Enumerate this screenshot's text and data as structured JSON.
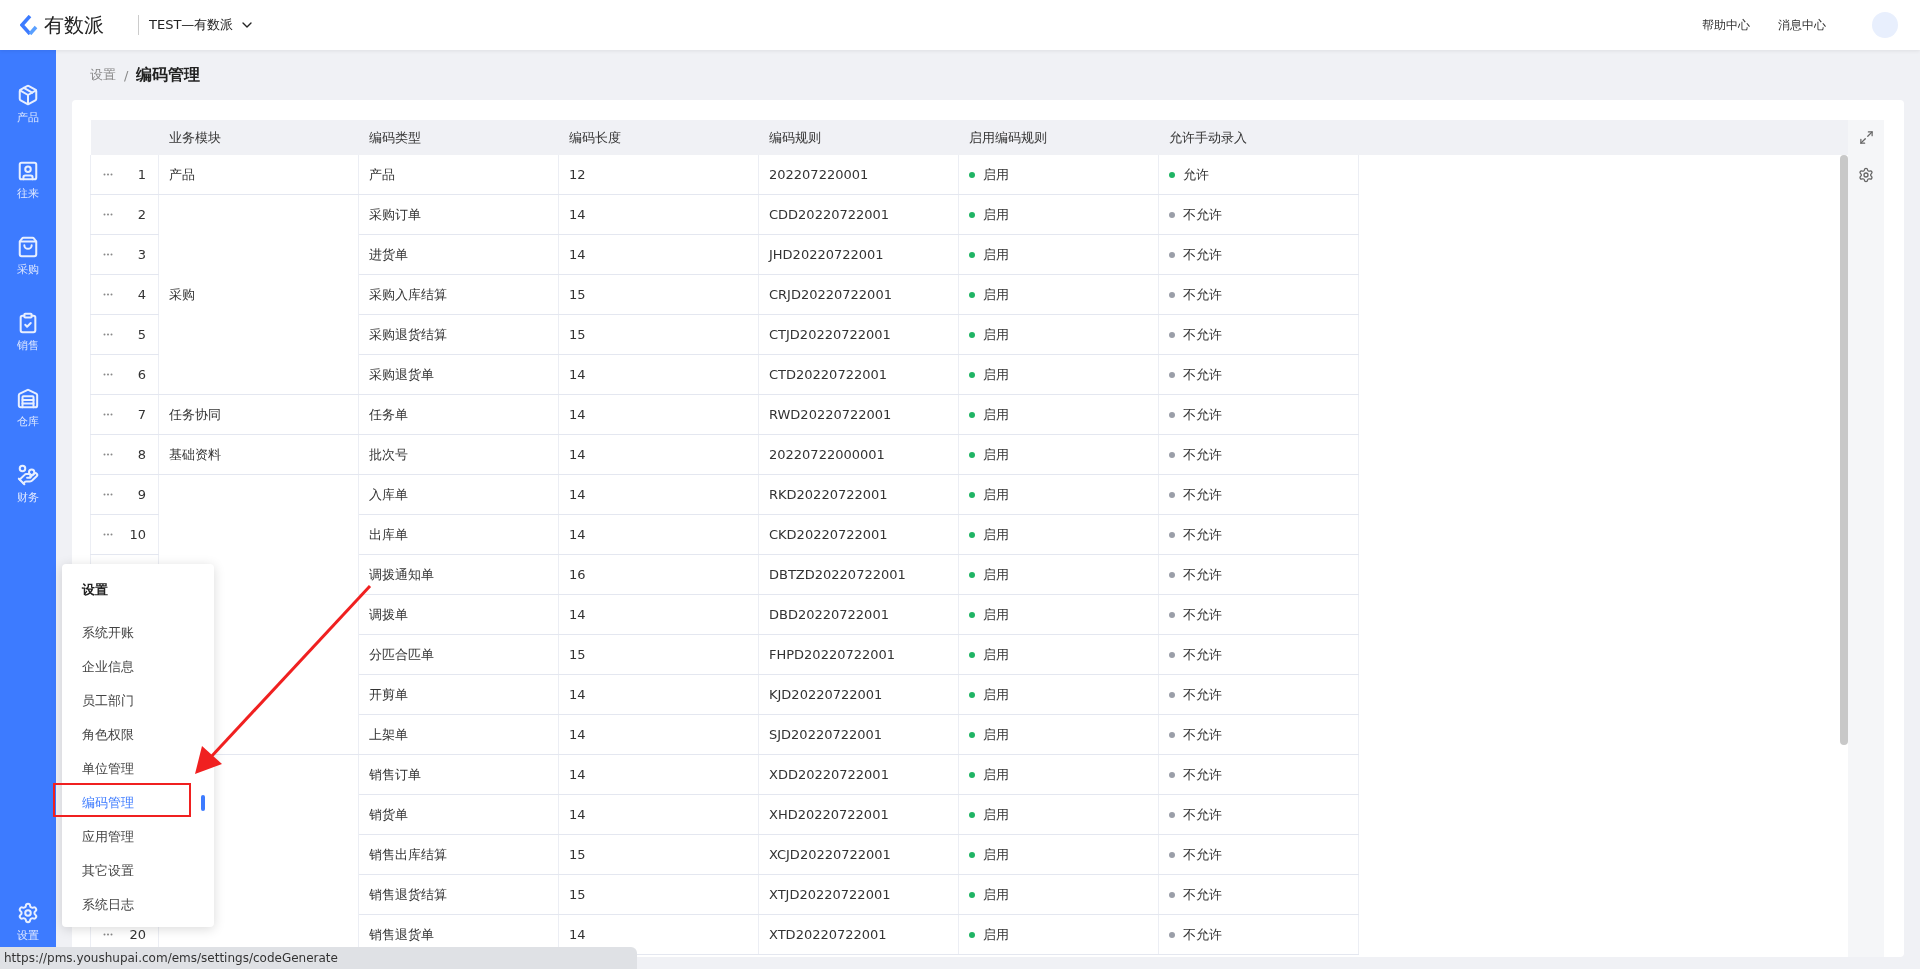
{
  "header": {
    "brand": "有数派",
    "workspace": "TEST—有数派",
    "links": [
      "帮助中心",
      "消息中心"
    ]
  },
  "sidebar": {
    "items": [
      {
        "label": "产品"
      },
      {
        "label": "往来"
      },
      {
        "label": "采购"
      },
      {
        "label": "销售"
      },
      {
        "label": "仓库"
      },
      {
        "label": "财务"
      }
    ],
    "bottom": {
      "label": "设置"
    }
  },
  "breadcrumb": {
    "parent": "设置",
    "separator": "/",
    "current": "编码管理"
  },
  "table": {
    "columns": [
      "业务模块",
      "编码类型",
      "编码长度",
      "编码规则",
      "启用编码规则",
      "允许手动录入"
    ],
    "groups": [
      {
        "module": "产品",
        "rows": [
          {
            "no": "1",
            "type": "产品",
            "length": "12",
            "rule": "202207220001",
            "enabled": {
              "text": "启用",
              "on": true
            },
            "manual": {
              "text": "允许",
              "on": true
            }
          }
        ]
      },
      {
        "module": "采购",
        "rows": [
          {
            "no": "2",
            "type": "采购订单",
            "length": "14",
            "rule": "CDD20220722001",
            "enabled": {
              "text": "启用",
              "on": true
            },
            "manual": {
              "text": "不允许",
              "on": false
            }
          },
          {
            "no": "3",
            "type": "进货单",
            "length": "14",
            "rule": "JHD20220722001",
            "enabled": {
              "text": "启用",
              "on": true
            },
            "manual": {
              "text": "不允许",
              "on": false
            }
          },
          {
            "no": "4",
            "type": "采购入库结算",
            "length": "15",
            "rule": "CRJD20220722001",
            "enabled": {
              "text": "启用",
              "on": true
            },
            "manual": {
              "text": "不允许",
              "on": false
            }
          },
          {
            "no": "5",
            "type": "采购退货结算",
            "length": "15",
            "rule": "CTJD20220722001",
            "enabled": {
              "text": "启用",
              "on": true
            },
            "manual": {
              "text": "不允许",
              "on": false
            }
          },
          {
            "no": "6",
            "type": "采购退货单",
            "length": "14",
            "rule": "CTD20220722001",
            "enabled": {
              "text": "启用",
              "on": true
            },
            "manual": {
              "text": "不允许",
              "on": false
            }
          }
        ]
      },
      {
        "module": "任务协同",
        "rows": [
          {
            "no": "7",
            "type": "任务单",
            "length": "14",
            "rule": "RWD20220722001",
            "enabled": {
              "text": "启用",
              "on": true
            },
            "manual": {
              "text": "不允许",
              "on": false
            }
          }
        ]
      },
      {
        "module": "基础资料",
        "rows": [
          {
            "no": "8",
            "type": "批次号",
            "length": "14",
            "rule": "20220722000001",
            "enabled": {
              "text": "启用",
              "on": true
            },
            "manual": {
              "text": "不允许",
              "on": false
            }
          }
        ]
      },
      {
        "rows": [
          {
            "no": "9",
            "type": "入库单",
            "length": "14",
            "rule": "RKD20220722001",
            "enabled": {
              "text": "启用",
              "on": true
            },
            "manual": {
              "text": "不允许",
              "on": false
            }
          },
          {
            "no": "10",
            "type": "出库单",
            "length": "14",
            "rule": "CKD20220722001",
            "enabled": {
              "text": "启用",
              "on": true
            },
            "manual": {
              "text": "不允许",
              "on": false
            }
          },
          {
            "type": "调拨通知单",
            "length": "16",
            "rule": "DBTZD20220722001",
            "enabled": {
              "text": "启用",
              "on": true
            },
            "manual": {
              "text": "不允许",
              "on": false
            }
          },
          {
            "type": "调拨单",
            "length": "14",
            "rule": "DBD20220722001",
            "enabled": {
              "text": "启用",
              "on": true
            },
            "manual": {
              "text": "不允许",
              "on": false
            }
          },
          {
            "type": "分匹合匹单",
            "length": "15",
            "rule": "FHPD20220722001",
            "enabled": {
              "text": "启用",
              "on": true
            },
            "manual": {
              "text": "不允许",
              "on": false
            }
          },
          {
            "type": "开剪单",
            "length": "14",
            "rule": "KJD20220722001",
            "enabled": {
              "text": "启用",
              "on": true
            },
            "manual": {
              "text": "不允许",
              "on": false
            }
          },
          {
            "type": "上架单",
            "length": "14",
            "rule": "SJD20220722001",
            "enabled": {
              "text": "启用",
              "on": true
            },
            "manual": {
              "text": "不允许",
              "on": false
            }
          }
        ]
      },
      {
        "rows": [
          {
            "type": "销售订单",
            "length": "14",
            "rule": "XDD20220722001",
            "enabled": {
              "text": "启用",
              "on": true
            },
            "manual": {
              "text": "不允许",
              "on": false
            }
          },
          {
            "type": "销货单",
            "length": "14",
            "rule": "XHD20220722001",
            "enabled": {
              "text": "启用",
              "on": true
            },
            "manual": {
              "text": "不允许",
              "on": false
            }
          },
          {
            "type": "销售出库结算",
            "length": "15",
            "rule": "XCJD20220722001",
            "enabled": {
              "text": "启用",
              "on": true
            },
            "manual": {
              "text": "不允许",
              "on": false
            }
          },
          {
            "type": "销售退货结算",
            "length": "15",
            "rule": "XTJD20220722001",
            "enabled": {
              "text": "启用",
              "on": true
            },
            "manual": {
              "text": "不允许",
              "on": false
            }
          },
          {
            "no": "20",
            "type": "销售退货单",
            "length": "14",
            "rule": "XTD20220722001",
            "enabled": {
              "text": "启用",
              "on": true
            },
            "manual": {
              "text": "不允许",
              "on": false
            }
          }
        ]
      }
    ]
  },
  "settings_menu": {
    "title": "设置",
    "items": [
      {
        "label": "系统开账",
        "selected": false
      },
      {
        "label": "企业信息",
        "selected": false
      },
      {
        "label": "员工部门",
        "selected": false
      },
      {
        "label": "角色权限",
        "selected": false
      },
      {
        "label": "单位管理",
        "selected": false
      },
      {
        "label": "编码管理",
        "selected": true
      },
      {
        "label": "应用管理",
        "selected": false
      },
      {
        "label": "其它设置",
        "selected": false
      },
      {
        "label": "系统日志",
        "selected": false
      }
    ]
  },
  "status_bar": {
    "url": "https://pms.youshupai.com/ems/settings/codeGenerate"
  }
}
